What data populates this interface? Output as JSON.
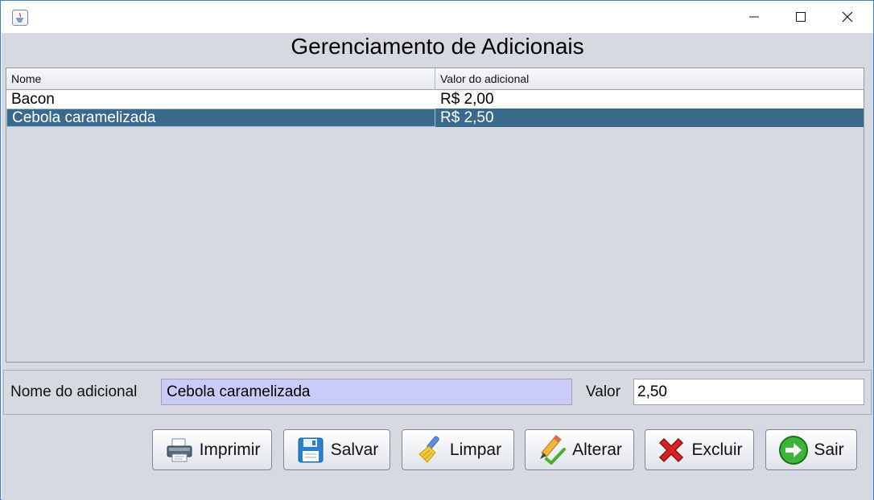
{
  "window": {
    "app_icon": "java-icon",
    "controls": [
      "minimize-icon",
      "maximize-icon",
      "close-icon"
    ]
  },
  "header": {
    "title": "Gerenciamento de Adicionais"
  },
  "table": {
    "columns": [
      "Nome",
      "Valor do adicional"
    ],
    "rows": [
      {
        "nome": "Bacon",
        "valor": "R$ 2,00",
        "selected": false
      },
      {
        "nome": "Cebola caramelizada",
        "valor": "R$ 2,50",
        "selected": true
      }
    ]
  },
  "form": {
    "nome_label": "Nome do adicional",
    "nome_value": "Cebola caramelizada",
    "valor_label": "Valor",
    "valor_value": "2,50"
  },
  "buttons": {
    "imprimir": {
      "label": "Imprimir",
      "icon": "printer-icon"
    },
    "salvar": {
      "label": "Salvar",
      "icon": "floppy-disk-icon"
    },
    "limpar": {
      "label": "Limpar",
      "icon": "broom-icon"
    },
    "alterar": {
      "label": "Alterar",
      "icon": "pencil-icon"
    },
    "excluir": {
      "label": "Excluir",
      "icon": "red-x-icon"
    },
    "sair": {
      "label": "Sair",
      "icon": "arrow-right-icon"
    }
  },
  "colors": {
    "selection": "#396a8e",
    "nome_field_bg": "#cbcbf9",
    "panel_bg": "#d6d9df"
  }
}
